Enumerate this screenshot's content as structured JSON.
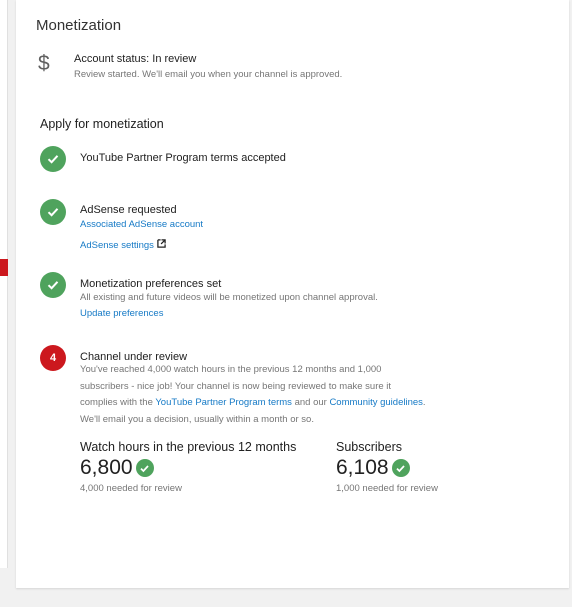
{
  "card": {
    "title": "Monetization"
  },
  "account": {
    "status": "Account status: In review",
    "subtitle": "Review started. We'll email you when your channel is approved."
  },
  "apply": {
    "title": "Apply for monetization",
    "steps": [
      {
        "title": "YouTube Partner Program terms accepted",
        "state": "done"
      },
      {
        "title": "AdSense requested",
        "state": "done",
        "links": [
          "Associated AdSense account",
          "AdSense settings"
        ]
      },
      {
        "title": "Monetization preferences set",
        "state": "done",
        "subtitle": "All existing and future videos will be monetized upon channel approval.",
        "link": "Update preferences"
      },
      {
        "title": "Channel under review",
        "state": "pending",
        "number": "4",
        "desc_line1": "You've reached 4,000 watch hours in the previous 12 months and 1,000",
        "desc_line2": "subscribers - nice job! Your channel is now being reviewed to make sure it",
        "desc_line3_pre": "complies with the ",
        "desc_link1": "YouTube Partner Program terms",
        "desc_line3_mid": " and our ",
        "desc_link2": "Community guidelines",
        "desc_line3_post": ".",
        "desc_line4": "We'll email you a decision, usually within a month or so."
      }
    ]
  },
  "stats": {
    "watch": {
      "label": "Watch hours in the previous 12 months",
      "value": "6,800",
      "note": "4,000 needed for review"
    },
    "subs": {
      "label": "Subscribers",
      "value": "6,108",
      "note": "1,000 needed for review"
    }
  },
  "colors": {
    "success": "#4fa35d",
    "alert": "#cc181e",
    "link": "#167ac6"
  },
  "icons": {
    "account": "dollar-icon",
    "done": "check-circle-icon",
    "external": "external-link-icon"
  }
}
